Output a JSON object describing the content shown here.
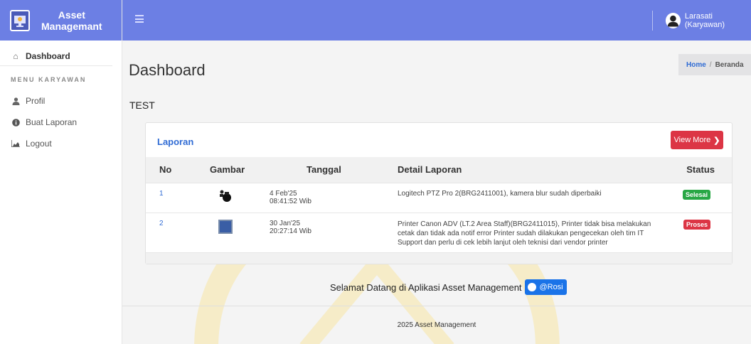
{
  "brand": {
    "line1": "Asset",
    "line2": "Managemant"
  },
  "sidebar": {
    "dashboard": "Dashboard",
    "section_heading": "MENU KARYAWAN",
    "items": [
      {
        "label": "Profil",
        "icon": "user-icon"
      },
      {
        "label": "Buat Laporan",
        "icon": "info-circle-icon"
      },
      {
        "label": "Logout",
        "icon": "chart-area-icon"
      }
    ]
  },
  "topbar": {
    "user_name": "Larasati (Karyawan)"
  },
  "page": {
    "title": "Dashboard",
    "test_text": "TEST"
  },
  "breadcrumb": {
    "home": "Home",
    "separator": "/",
    "current": "Beranda"
  },
  "laporan": {
    "title": "Laporan",
    "view_more": "View More",
    "columns": [
      "No",
      "Gambar",
      "Tanggal",
      "Detail Laporan",
      "Status"
    ],
    "rows": [
      {
        "no": "1",
        "date": "4 Feb'25",
        "time": "08:41:52 Wib",
        "detail": "Logitech PTZ Pro 2(BRG2411001), kamera blur sudah diperbaiki",
        "status": "Selesai",
        "status_color": "#28a745"
      },
      {
        "no": "2",
        "date": "30 Jan'25",
        "time": "20:27:14 Wib",
        "detail": "Printer Canon ADV (LT.2 Area Staff)(BRG2411015), Printer tidak bisa melakukan cetak dan tidak ada notif error Printer sudah dilakukan pengecekan oleh tim IT Support dan perlu di cek lebih lanjut oleh teknisi dari vendor printer",
        "status": "Proses",
        "status_color": "#dc3545"
      }
    ]
  },
  "welcome": {
    "text": "Selamat Datang di Aplikasi Asset Management",
    "button": "@Rosi"
  },
  "footer": {
    "text": "2025 Asset Management"
  },
  "colors": {
    "primary": "#6c7fe4",
    "link": "#2f6bd4",
    "danger": "#dc3545",
    "success": "#28a745",
    "button_blue": "#1a73e8"
  }
}
